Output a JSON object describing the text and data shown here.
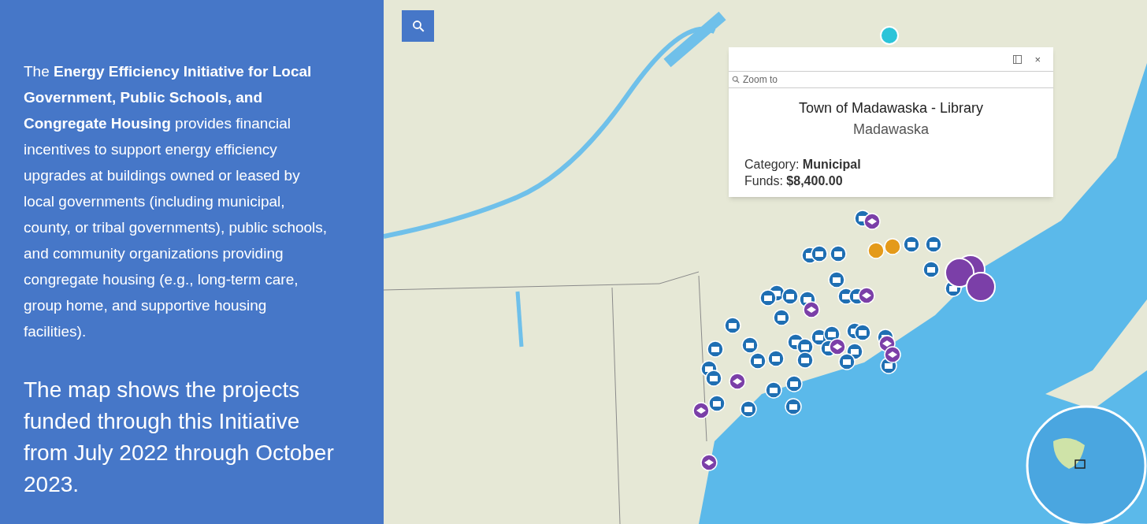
{
  "sidebar": {
    "intro": "The **Energy Efficiency Initiative for Local Government, Public Schools, and Congregate Housing** provides financial incentives to support energy efficiency upgrades at buildings owned or leased by local governments (including municipal, county, or tribal governments), public schools, and community organizations providing congregate housing (e.g., long-term care, group home, and supportive housing facilities).",
    "summary": "The map shows the projects funded through this Initiative from July 2022 through October 2023."
  },
  "popup": {
    "zoom_link": "Zoom to",
    "close": "×",
    "title": "Town of Madawaska - Library",
    "subtitle": "Madawaska",
    "fields": [
      {
        "label": "Category:",
        "value": "Municipal"
      },
      {
        "label": "Funds:",
        "value": "$8,400.00"
      }
    ]
  }
}
